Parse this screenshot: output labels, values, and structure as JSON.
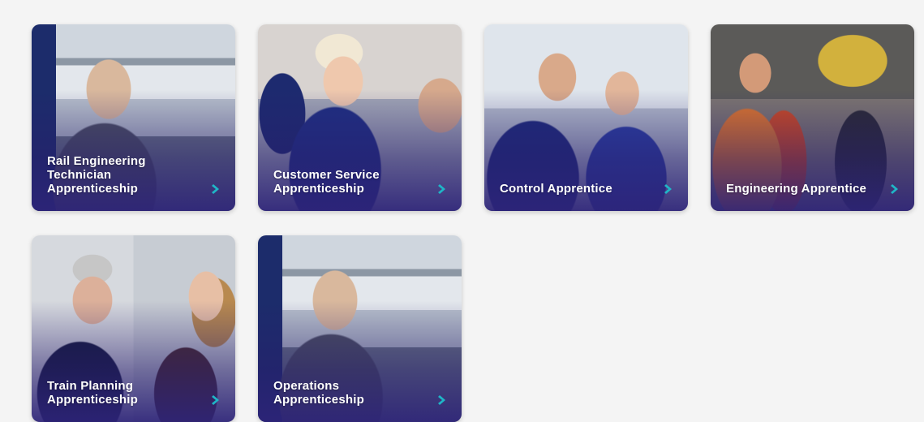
{
  "cards": [
    {
      "title": "Rail Engineering\nTechnician\nApprenticeship",
      "chevron_icon": "chevron-right-icon"
    },
    {
      "title": "Customer Service\nApprenticeship",
      "chevron_icon": "chevron-right-icon"
    },
    {
      "title": "Control Apprentice",
      "chevron_icon": "chevron-right-icon"
    },
    {
      "title": "Engineering Apprentice",
      "chevron_icon": "chevron-right-icon"
    },
    {
      "title": "Train Planning\nApprenticeship",
      "chevron_icon": "chevron-right-icon"
    },
    {
      "title": "Operations\nApprenticeship",
      "chevron_icon": "chevron-right-icon"
    }
  ],
  "colors": {
    "background": "#f4f4f4",
    "overlay": "#2d2378",
    "chevron": "#1fb6c7",
    "title_text": "#ffffff"
  }
}
